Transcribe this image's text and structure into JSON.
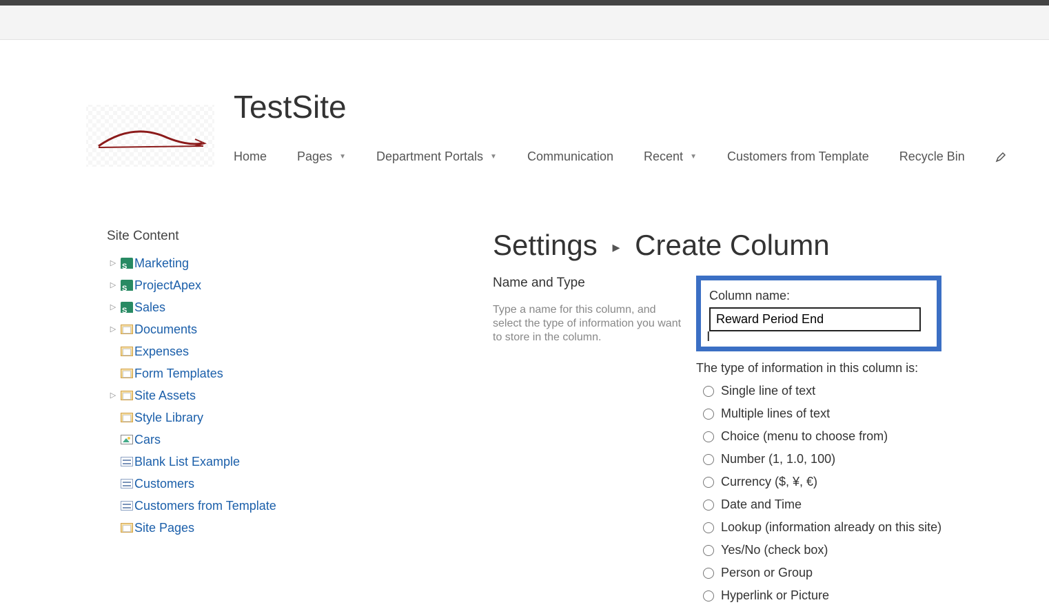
{
  "site": {
    "title": "TestSite"
  },
  "nav": {
    "items": [
      {
        "label": "Home",
        "hasDropdown": false
      },
      {
        "label": "Pages",
        "hasDropdown": true
      },
      {
        "label": "Department Portals",
        "hasDropdown": true
      },
      {
        "label": "Communication",
        "hasDropdown": false
      },
      {
        "label": "Recent",
        "hasDropdown": true
      },
      {
        "label": "Customers from Template",
        "hasDropdown": false
      },
      {
        "label": "Recycle Bin",
        "hasDropdown": false
      }
    ]
  },
  "sidebar": {
    "title": "Site Content",
    "items": [
      {
        "label": "Marketing",
        "icon": "sp",
        "expandable": true
      },
      {
        "label": "ProjectApex",
        "icon": "sp",
        "expandable": true
      },
      {
        "label": "Sales",
        "icon": "sp",
        "expandable": true
      },
      {
        "label": "Documents",
        "icon": "lib",
        "expandable": true
      },
      {
        "label": "Expenses",
        "icon": "lib",
        "expandable": false
      },
      {
        "label": "Form Templates",
        "icon": "lib",
        "expandable": false
      },
      {
        "label": "Site Assets",
        "icon": "lib",
        "expandable": true
      },
      {
        "label": "Style Library",
        "icon": "lib",
        "expandable": false
      },
      {
        "label": "Cars",
        "icon": "pic",
        "expandable": false
      },
      {
        "label": "Blank List Example",
        "icon": "list",
        "expandable": false
      },
      {
        "label": "Customers",
        "icon": "list",
        "expandable": false
      },
      {
        "label": "Customers from Template",
        "icon": "list",
        "expandable": false
      },
      {
        "label": "Site Pages",
        "icon": "lib",
        "expandable": false
      }
    ]
  },
  "page": {
    "settings_label": "Settings",
    "title": "Create Column",
    "section_heading": "Name and Type",
    "section_desc": "Type a name for this column, and select the type of information you want to store in the column.",
    "column_name_label": "Column name:",
    "column_name_value": "Reward Period End",
    "type_label": "The type of information in this column is:",
    "types": [
      "Single line of text",
      "Multiple lines of text",
      "Choice (menu to choose from)",
      "Number (1, 1.0, 100)",
      "Currency ($, ¥, €)",
      "Date and Time",
      "Lookup (information already on this site)",
      "Yes/No (check box)",
      "Person or Group",
      "Hyperlink or Picture"
    ]
  }
}
